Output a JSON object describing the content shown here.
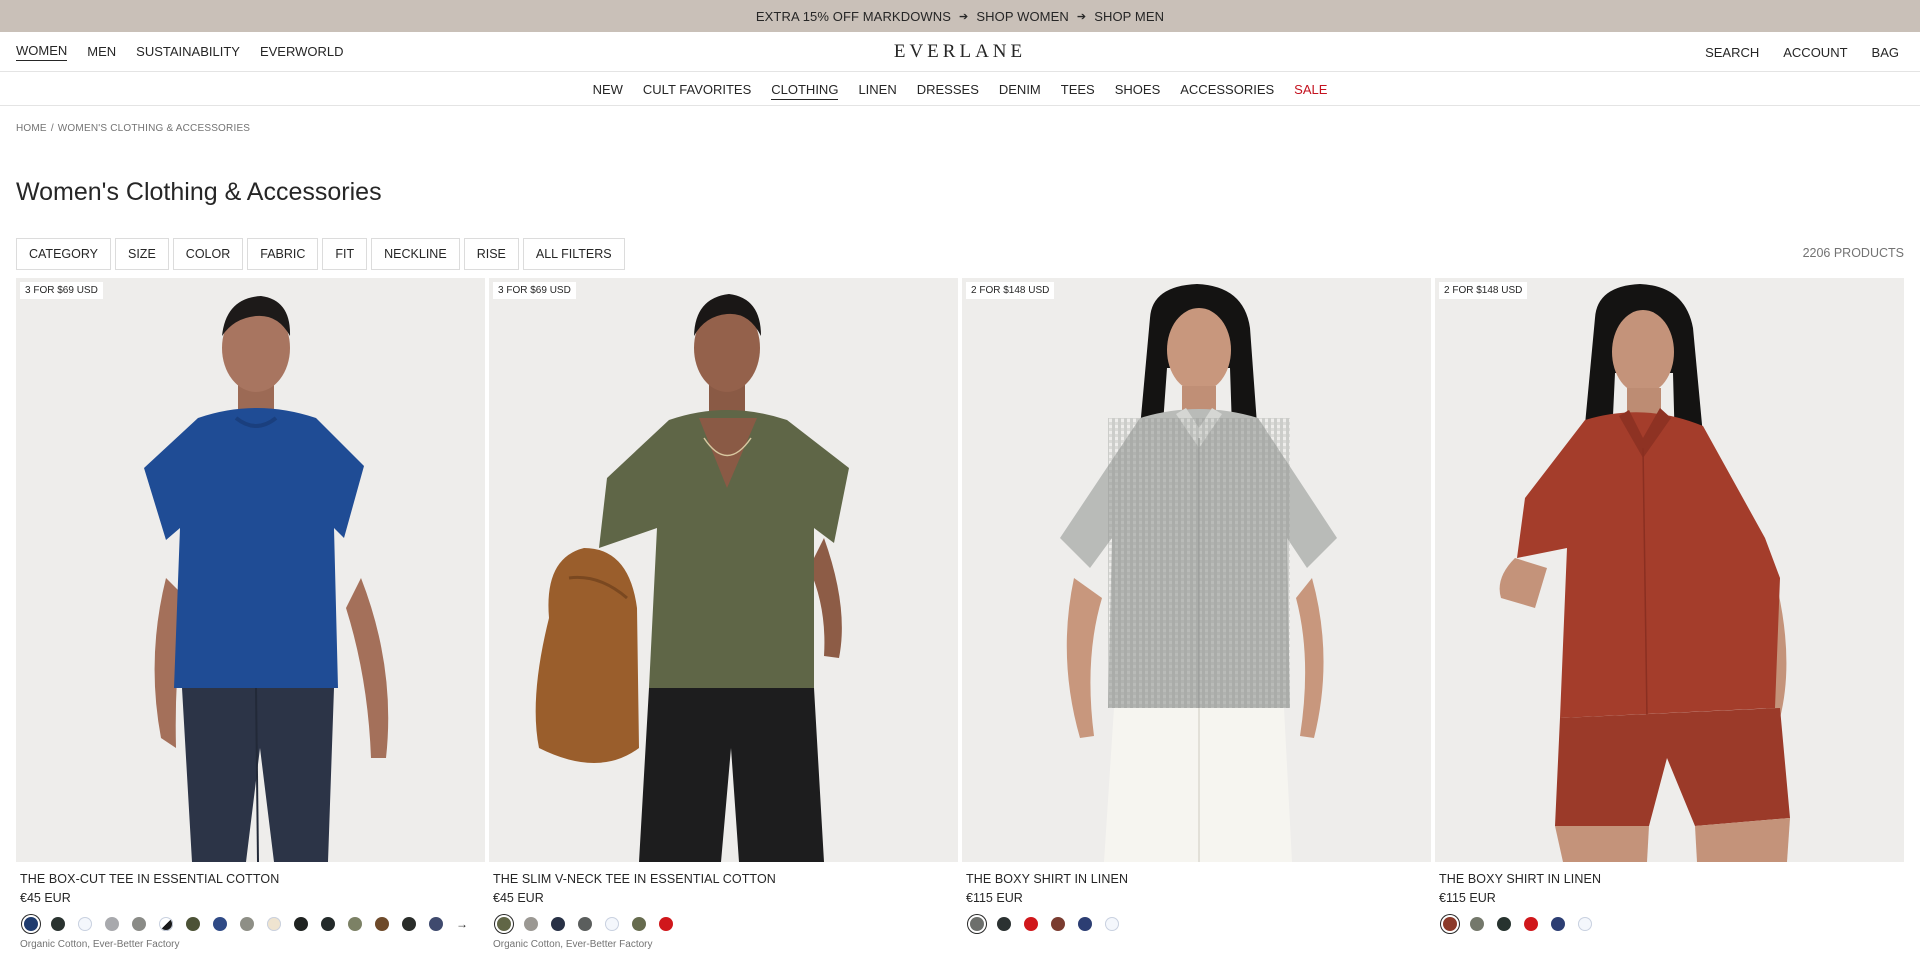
{
  "promo": {
    "items": [
      "EXTRA 15% OFF MARKDOWNS",
      "SHOP WOMEN",
      "SHOP MEN"
    ],
    "separator": "➔"
  },
  "header": {
    "gender_nav": [
      "WOMEN",
      "MEN",
      "SUSTAINABILITY",
      "EVERWORLD"
    ],
    "logo": "EVERLANE",
    "utility": [
      "SEARCH",
      "ACCOUNT",
      "BAG"
    ]
  },
  "category_nav": [
    "NEW",
    "CULT FAVORITES",
    "CLOTHING",
    "LINEN",
    "DRESSES",
    "DENIM",
    "TEES",
    "SHOES",
    "ACCESSORIES",
    "SALE"
  ],
  "breadcrumb": {
    "home": "HOME",
    "sep": "/",
    "current": "WOMEN'S CLOTHING & ACCESSORIES"
  },
  "page_title": "Women's Clothing & Accessories",
  "filters": [
    "CATEGORY",
    "SIZE",
    "COLOR",
    "FABRIC",
    "FIT",
    "NECKLINE",
    "RISE",
    "ALL FILTERS"
  ],
  "product_count": "2206 PRODUCTS",
  "products": [
    {
      "badge": "3 FOR $69 USD",
      "name": "THE BOX-CUT TEE IN ESSENTIAL COTTON",
      "price": "€45 EUR",
      "subtitle": "Organic Cotton, Ever-Better Factory",
      "swatches": [
        "#1f3b6e",
        "#2a3330",
        "#f4f7fc",
        "#a8a9ad",
        "#8a8b87",
        "half",
        "#4c5236",
        "#2f4a86",
        "#8e8f86",
        "#efe4d0",
        "#1f2321",
        "#232a2a",
        "#7c8165",
        "#6e4a2a",
        "#2a2d2a",
        "#3f4a6e"
      ],
      "selected_swatch": 0,
      "has_more_arrow": true,
      "more_arrow": "→"
    },
    {
      "badge": "3 FOR $69 USD",
      "name": "THE SLIM V-NECK TEE IN ESSENTIAL COTTON",
      "price": "€45 EUR",
      "subtitle": "Organic Cotton, Ever-Better Factory",
      "swatches": [
        "#616646",
        "#9b9893",
        "#283146",
        "#5b5e5d",
        "#f4f7fc",
        "#666b4e",
        "#d0171b"
      ],
      "selected_swatch": 0,
      "has_more_arrow": false
    },
    {
      "badge": "2 FOR $148 USD",
      "name": "THE BOXY SHIRT IN LINEN",
      "price": "€115 EUR",
      "subtitle": "",
      "swatches": [
        "#6d6f6c",
        "#2b3131",
        "#d0171b",
        "#7a3c30",
        "#2c3e73",
        "#f4f7fc"
      ],
      "selected_swatch": 0,
      "has_more_arrow": false
    },
    {
      "badge": "2 FOR $148 USD",
      "name": "THE BOXY SHIRT IN LINEN",
      "price": "€115 EUR",
      "subtitle": "",
      "swatches": [
        "#8c3a2a",
        "#74786b",
        "#27332f",
        "#d0171b",
        "#2c3e73",
        "#f4f7fc"
      ],
      "selected_swatch": 0,
      "has_more_arrow": false
    }
  ],
  "colors": {
    "promo_bg": "#c9c0b8",
    "sale_red": "#c4121f",
    "photo_bg": "#eeedeb"
  }
}
